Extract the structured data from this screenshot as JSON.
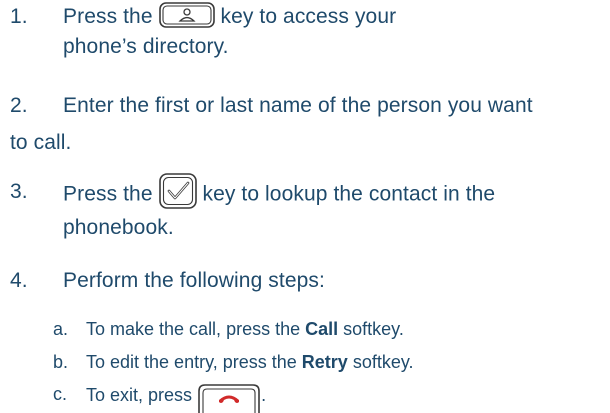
{
  "steps": [
    {
      "num": "1.",
      "before": "Press the",
      "after": "key  to access your",
      "line2": "phone’s directory.",
      "icon": "person-directory-key-icon"
    },
    {
      "num": "2.",
      "line1": "Enter the first or last name of the person you want",
      "line2": "to call."
    },
    {
      "num": "3.",
      "before": "Press the",
      "after": "key to lookup the contact in the",
      "line2": "phonebook.",
      "icon": "checkmark-key-icon"
    },
    {
      "num": "4.",
      "line1": "Perform the following steps:"
    }
  ],
  "substeps": [
    {
      "num": "a.",
      "before": "To make the call, press the",
      "bold": "Call",
      "after": "softkey."
    },
    {
      "num": "b.",
      "before": "To edit the entry, press the",
      "bold": "Retry",
      "after": "softkey."
    },
    {
      "num": "c.",
      "before": "To exit, press",
      "after": ".",
      "icon": "end-call-key-icon"
    }
  ],
  "colors": {
    "text": "#1f4a6b",
    "key_border": "#3a3a3a",
    "end_call_red": "#d12a2a"
  }
}
